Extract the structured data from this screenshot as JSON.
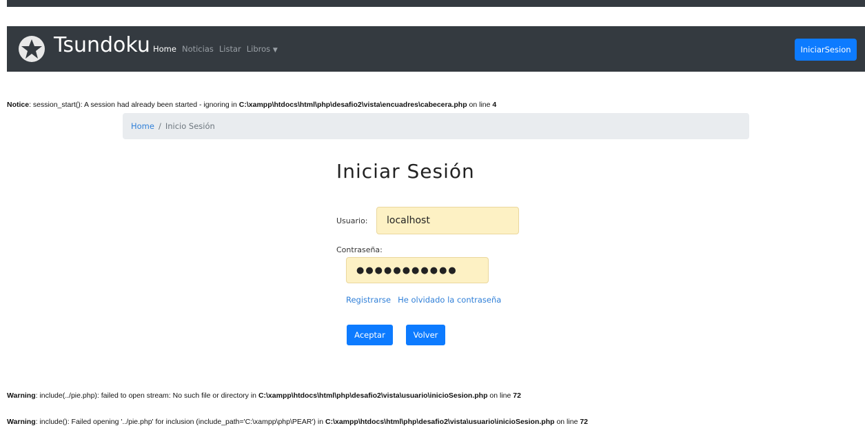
{
  "navbar": {
    "brand": "Tsundoku",
    "links": [
      "Home",
      "Noticias",
      "Listar",
      "Libros"
    ],
    "login_button": "IniciarSesion"
  },
  "notice": {
    "label": "Notice",
    "message": ": session_start(): A session had already been started - ignoring in ",
    "path": "C:\\xampp\\htdocs\\html\\php\\desafio2\\vista\\encuadres\\cabecera.php",
    "line_text": " on line ",
    "line": "4"
  },
  "breadcrumb": {
    "home": "Home",
    "separator": "/",
    "current": "Inicio Sesión"
  },
  "form": {
    "title": "Iniciar Sesión",
    "user_label": "Usuario:",
    "user_value": "localhost",
    "password_label": "Contraseña:",
    "password_value": "●●●●●●●●●●●",
    "register_link": "Registrarse",
    "forgot_link": "He olvidado la contraseña",
    "accept_button": "Aceptar",
    "back_button": "Volver"
  },
  "warnings": [
    {
      "label": "Warning",
      "message": ": include(../pie.php): failed to open stream: No such file or directory in ",
      "path": "C:\\xampp\\htdocs\\html\\php\\desafio2\\vista\\usuario\\inicioSesion.php",
      "line_text": " on line ",
      "line": "72"
    },
    {
      "label": "Warning",
      "message": ": include(): Failed opening '../pie.php' for inclusion (include_path='C:\\xampp\\php\\PEAR') in ",
      "path": "C:\\xampp\\htdocs\\html\\php\\desafio2\\vista\\usuario\\inicioSesion.php",
      "line_text": " on line ",
      "line": "72"
    }
  ]
}
